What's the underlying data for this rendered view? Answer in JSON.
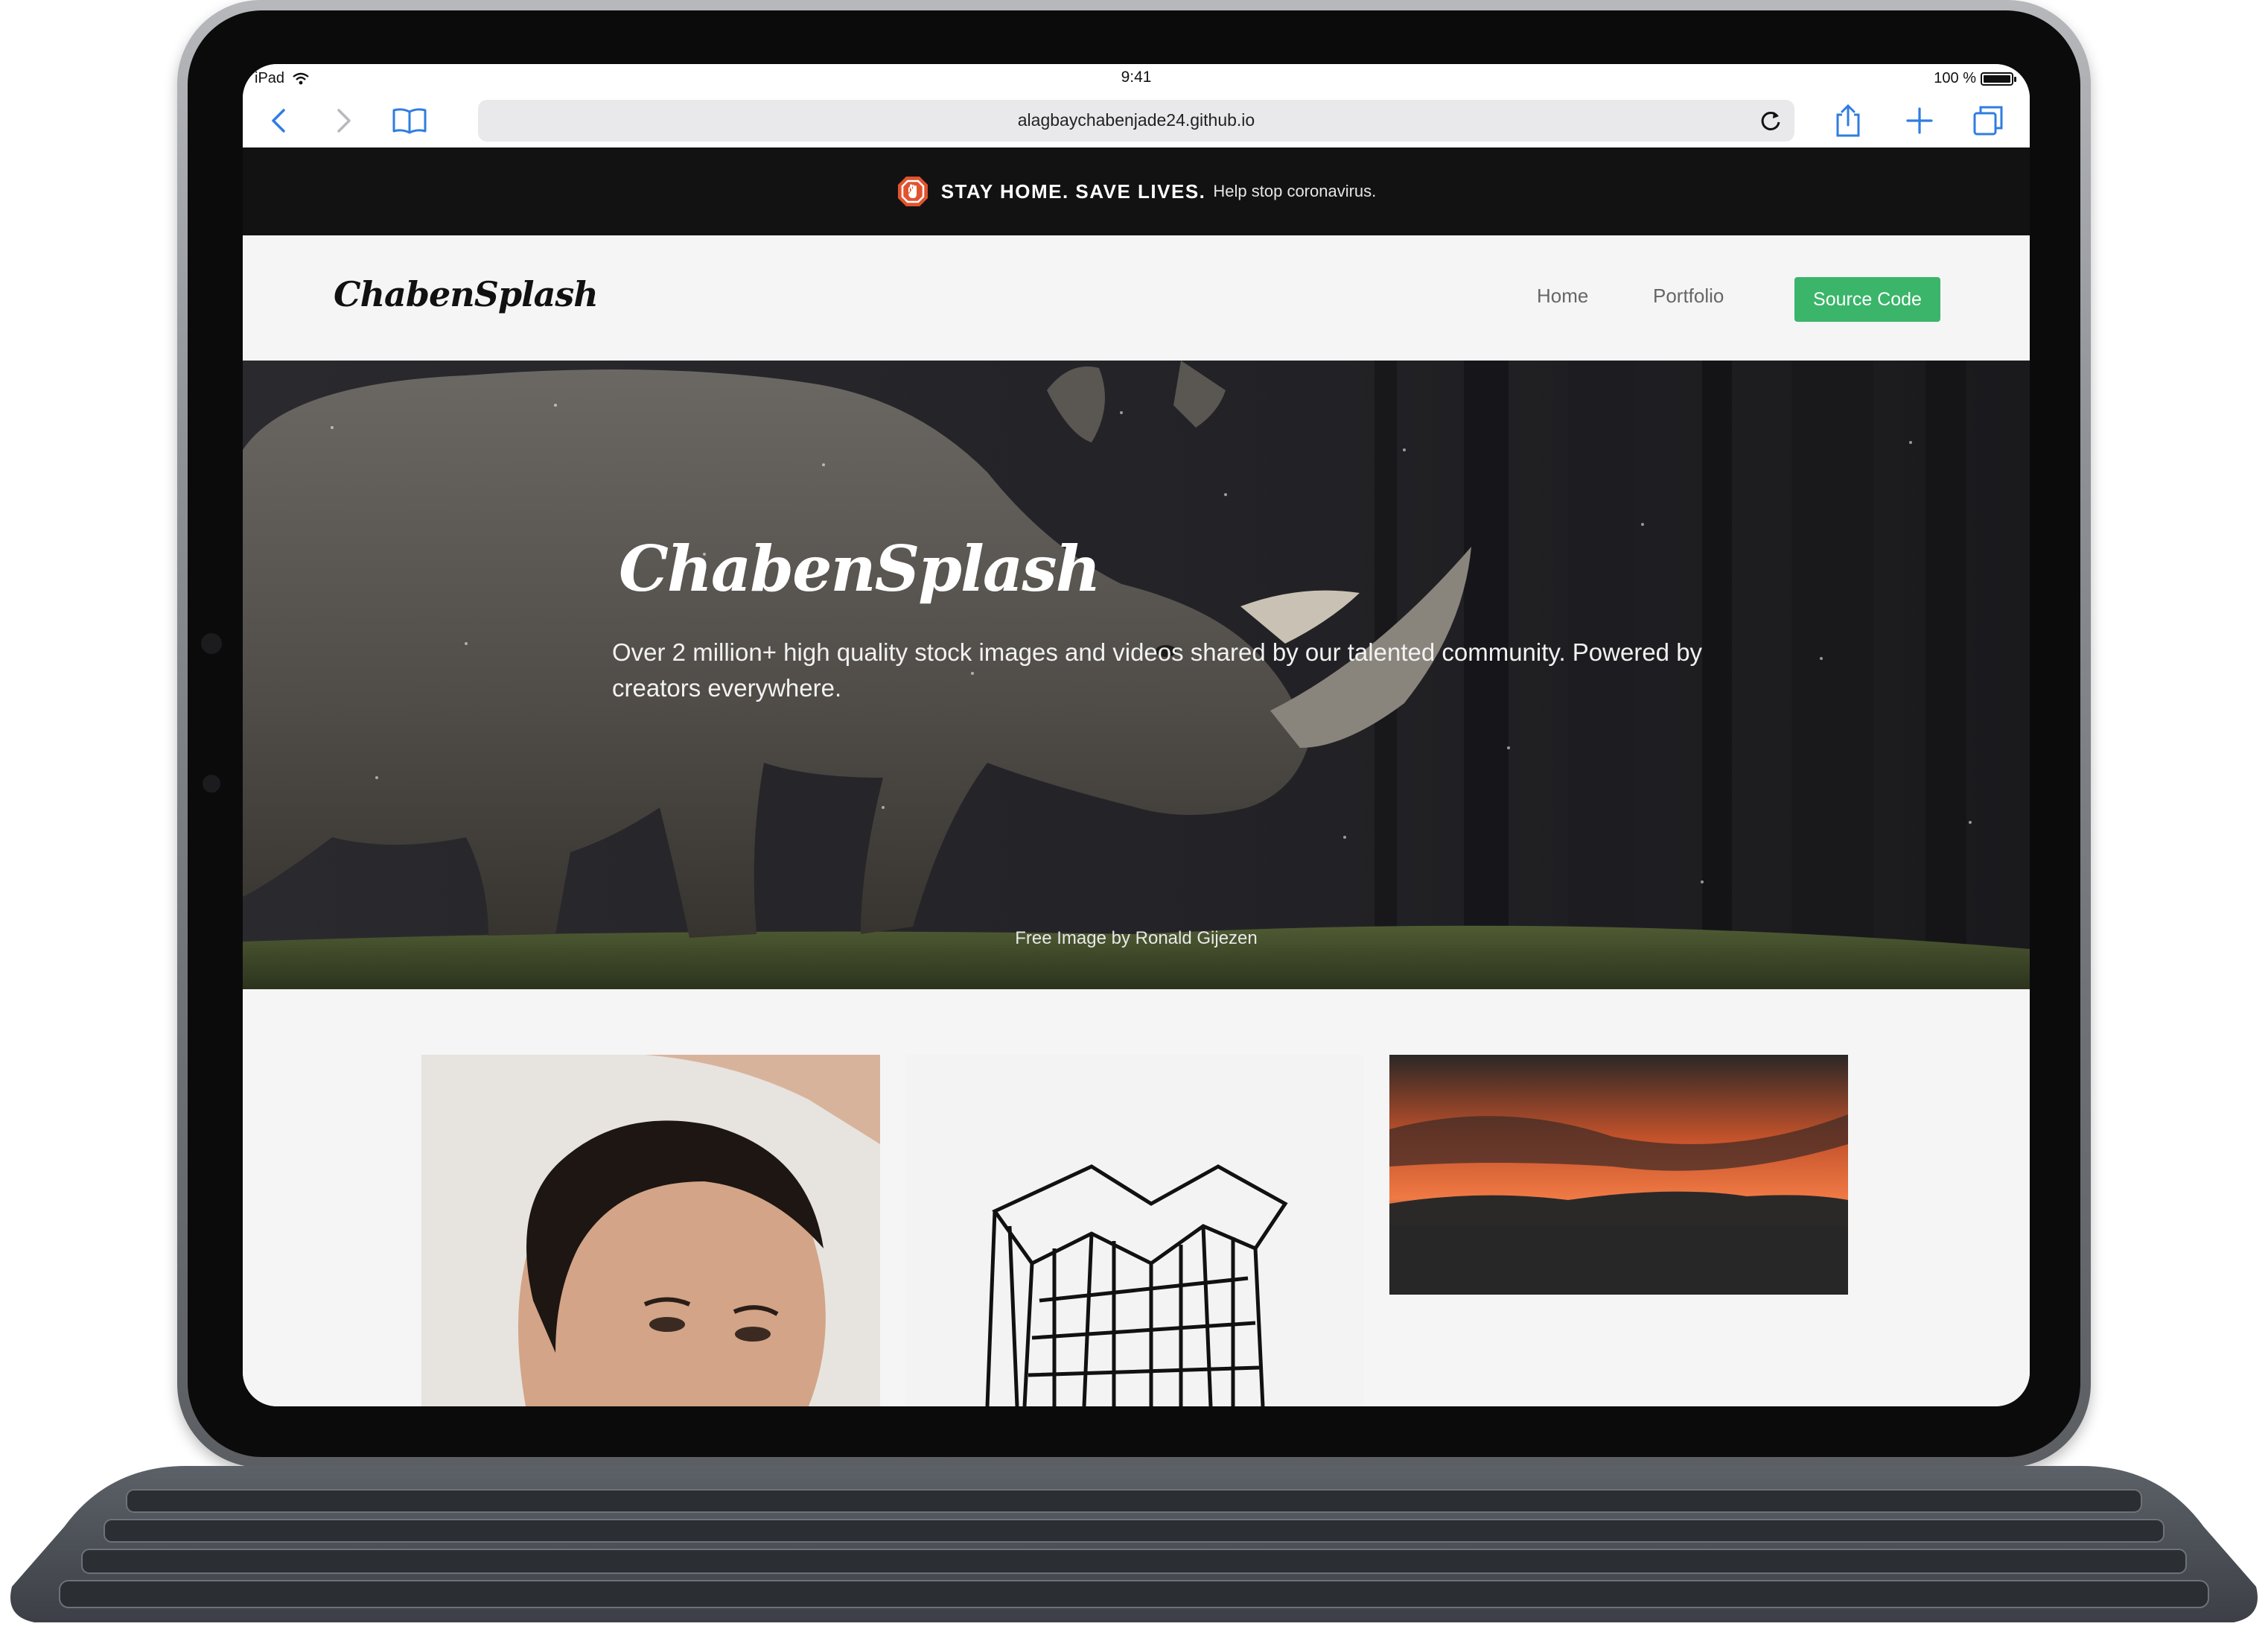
{
  "status_bar": {
    "device": "iPad",
    "time": "9:41",
    "battery_text": "100 %",
    "battery_level": 1.0
  },
  "browser": {
    "url": "alagbaychabenjade24.github.io"
  },
  "banner": {
    "headline": "STAY HOME. SAVE LIVES.",
    "subtext": "Help stop coronavirus."
  },
  "site_nav": {
    "logo": "ChabenSplash",
    "links": [
      "Home",
      "Portfolio"
    ],
    "cta": "Source Code",
    "cta_color": "#3ab56a"
  },
  "hero": {
    "title": "ChabenSplash",
    "subtitle": "Over 2 million+ high quality stock images and videos shared by our talented community. Powered by creators everywhere.",
    "credit": "Free Image by Ronald Gijezen"
  },
  "gallery": {
    "items": [
      {
        "subject": "portrait-photo"
      },
      {
        "subject": "architecture-photo"
      },
      {
        "subject": "sunset-photo"
      }
    ]
  },
  "icons": [
    "wifi-icon",
    "battery-icon",
    "back-icon",
    "forward-icon",
    "bookmarks-icon",
    "reload-icon",
    "share-icon",
    "new-tab-icon",
    "tabs-icon",
    "stop-sign-icon"
  ]
}
